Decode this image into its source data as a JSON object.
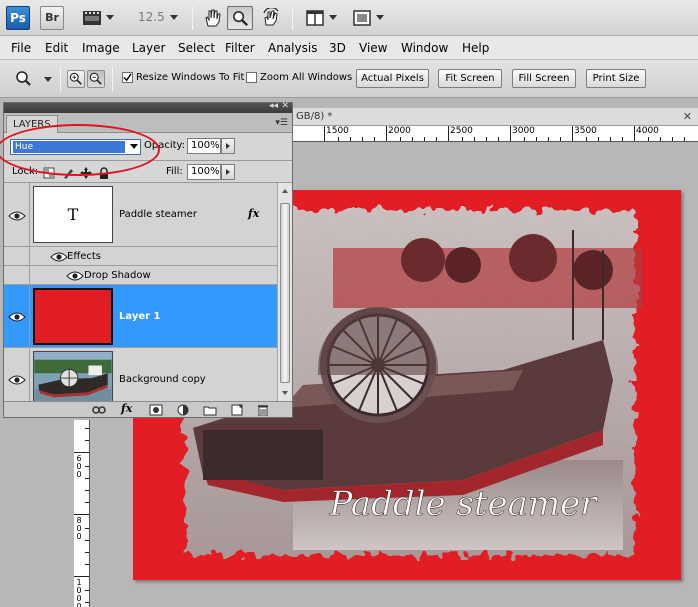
{
  "app_bar": {
    "ps_label": "Ps",
    "br_label": "Br",
    "zoom_level": "12.5"
  },
  "menu": [
    "File",
    "Edit",
    "Image",
    "Layer",
    "Select",
    "Filter",
    "Analysis",
    "3D",
    "View",
    "Window",
    "Help"
  ],
  "options_bar": {
    "resize_windows_label": "Resize Windows To Fit",
    "resize_windows_checked": true,
    "zoom_all_label": "Zoom All Windows",
    "zoom_all_checked": false,
    "buttons": [
      "Actual Pixels",
      "Fit Screen",
      "Fill Screen",
      "Print Size"
    ]
  },
  "document": {
    "tab_title": "GB/8) *",
    "ruler_labels": [
      "1500",
      "2000",
      "2500",
      "3000",
      "3500",
      "4000"
    ],
    "vruler_digits": [
      "6",
      "0",
      "0",
      "8",
      "0",
      "0",
      "1",
      "0",
      "0",
      "0"
    ],
    "image_text": "Paddle steamer"
  },
  "layers_panel": {
    "tab_label": "LAYERS",
    "blend_mode": "Hue",
    "opacity_label": "Opacity:",
    "opacity_value": "100%",
    "lock_label": "Lock:",
    "fill_label": "Fill:",
    "fill_value": "100%",
    "text_thumb_glyph": "T",
    "fx_label": "fx",
    "layers": [
      {
        "name": "Paddle steamer",
        "type": "text",
        "has_fx": true,
        "selected": false
      },
      {
        "name": "Layer 1",
        "type": "fill",
        "color": "#e21e24",
        "selected": true
      },
      {
        "name": "Background copy",
        "type": "image",
        "selected": false
      }
    ],
    "effects_label": "Effects",
    "drop_shadow_label": "Drop Shadow"
  },
  "colors": {
    "accent_selected": "#3399ff",
    "layer_red": "#e21e24",
    "annotation": "#e0141c"
  }
}
